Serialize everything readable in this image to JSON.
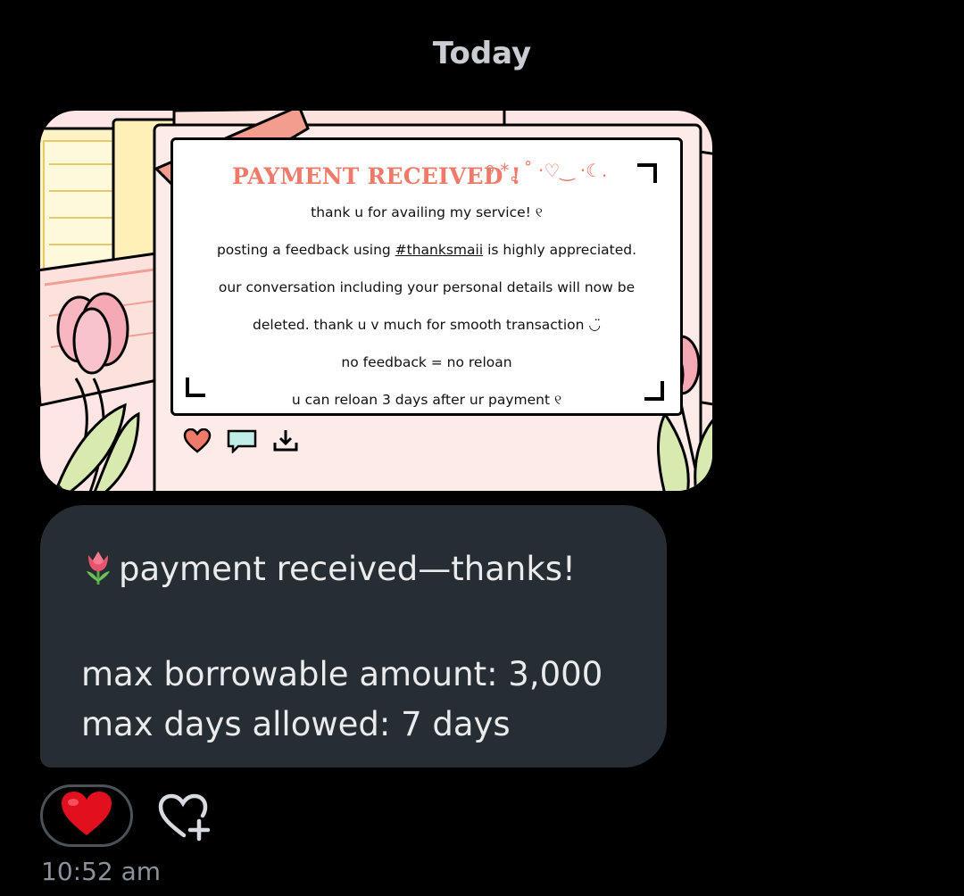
{
  "date_separator": "Today",
  "image_card": {
    "title": "PAYMENT RECEIVED !",
    "title_decoration": "୨·*˳ ˚ ·♡‿ ·☾.",
    "lines": [
      "thank u for availing my service! ୧",
      "posting a feedback using",
      "#thanksmaii",
      "is highly appreciated.",
      "our conversation including your personal details will now be",
      "deleted. thank u v much for smooth transaction ◡̈",
      "no feedback = no reloan",
      "u can reloan 3 days after ur payment ୧"
    ],
    "actions": [
      "heart-icon",
      "comment-icon",
      "download-icon"
    ],
    "colors": {
      "title": "#ef7a6a",
      "background": "#fde6e4",
      "tulip": "#f4a9b4",
      "leaf": "#d9eab0"
    }
  },
  "message": {
    "emoji": "tulip-icon",
    "line1": "payment received—thanks!",
    "line2": "max borrowable amount: 3,000",
    "line3": "max days allowed: 7 days"
  },
  "reactions": {
    "existing": "heart-emoji",
    "add_label_icon": "add-reaction-icon"
  },
  "timestamp": "10:52 am"
}
